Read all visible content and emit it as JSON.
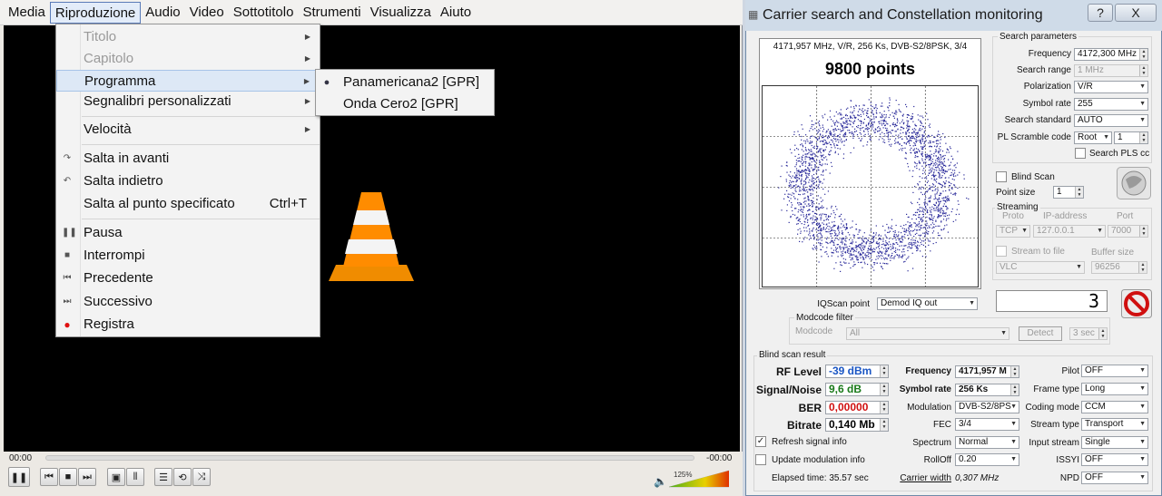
{
  "vlc": {
    "menubar": [
      "Media",
      "Riproduzione",
      "Audio",
      "Video",
      "Sottotitolo",
      "Strumenti",
      "Visualizza",
      "Aiuto"
    ],
    "menu": {
      "titolo": "Titolo",
      "capitolo": "Capitolo",
      "programma": "Programma",
      "segnalibri": "Segnalibri personalizzati",
      "velocita": "Velocità",
      "salta_avanti": "Salta in avanti",
      "salta_indietro": "Salta indietro",
      "salta_punto": "Salta al punto specificato",
      "salta_punto_sc": "Ctrl+T",
      "pausa": "Pausa",
      "interrompi": "Interrompi",
      "precedente": "Precedente",
      "successivo": "Successivo",
      "registra": "Registra"
    },
    "submenu": [
      "Panamericana2 [GPR]",
      "Onda Cero2 [GPR]"
    ],
    "time_elapsed": "00:00",
    "time_remaining": "-00:00",
    "volume": "125%"
  },
  "scan": {
    "title": "Carrier search and Constellation monitoring",
    "help": "?",
    "close": "X",
    "const_info": "4171,957 MHz, V/R, 256 Ks, DVB-S2/8PSK, 3/4",
    "points": "9800 points",
    "search_params": "Search parameters",
    "frequency_lbl": "Frequency",
    "frequency": "4172,300 MHz",
    "range_lbl": "Search range",
    "range": "1 MHz",
    "pol_lbl": "Polarization",
    "pol": "V/R",
    "sr_lbl": "Symbol rate",
    "sr": "255",
    "std_lbl": "Search standard",
    "std": "AUTO",
    "pls_lbl": "PL Scramble code",
    "pls_mode": "Root",
    "pls_val": "1",
    "search_pls": "Search PLS cc",
    "blind": "Blind Scan",
    "point_size_lbl": "Point size",
    "point_size": "1",
    "streaming": "Streaming",
    "proto_lbl": "Proto",
    "ip_lbl": "IP-address",
    "port_lbl": "Port",
    "proto": "TCP",
    "ip": "127.0.0.1",
    "port": "7000",
    "stream_file": "Stream to file",
    "buffer_lbl": "Buffer size",
    "vlc": "VLC",
    "buffer": "96256",
    "iq_lbl": "IQScan point",
    "iq": "Demod IQ out",
    "counter": "3",
    "modcode_filter": "Modcode filter",
    "modcode_lbl": "Modcode",
    "modcode": "All",
    "detect": "Detect",
    "sec": "3 sec",
    "blind_result": "Blind scan result",
    "rf_lbl": "RF Level",
    "rf": "-39 dBm",
    "snr_lbl": "Signal/Noise",
    "snr": "9,6 dB",
    "ber_lbl": "BER",
    "ber": "0,00000",
    "bitrate_lbl": "Bitrate",
    "bitrate": "0,140 Mb",
    "freq2_lbl": "Frequency",
    "freq2": "4171,957 M",
    "sr2_lbl": "Symbol rate",
    "sr2": "256 Ks",
    "mod_lbl": "Modulation",
    "mod": "DVB-S2/8PS",
    "fec_lbl": "FEC",
    "fec": "3/4",
    "spec_lbl": "Spectrum",
    "spec": "Normal",
    "roll_lbl": "RollOff",
    "roll": "0.20",
    "cw_lbl": "Carrier width",
    "cw": "0,307 MHz",
    "pilot_lbl": "Pilot",
    "pilot": "OFF",
    "frame_lbl": "Frame type",
    "frame": "Long",
    "coding_lbl": "Coding mode",
    "coding": "CCM",
    "stype_lbl": "Stream type",
    "stype": "Transport",
    "istream_lbl": "Input stream",
    "istream": "Single",
    "issyi_lbl": "ISSYI",
    "issyi": "OFF",
    "npd_lbl": "NPD",
    "npd": "OFF",
    "refresh": "Refresh signal info",
    "update": "Update modulation info",
    "elapsed": "Elapsed time: 35.57 sec"
  },
  "colors": {
    "rf": "#1a56c4",
    "snr": "#1a7a1a",
    "ber": "#d01010",
    "dots": "#2a2a9a"
  }
}
